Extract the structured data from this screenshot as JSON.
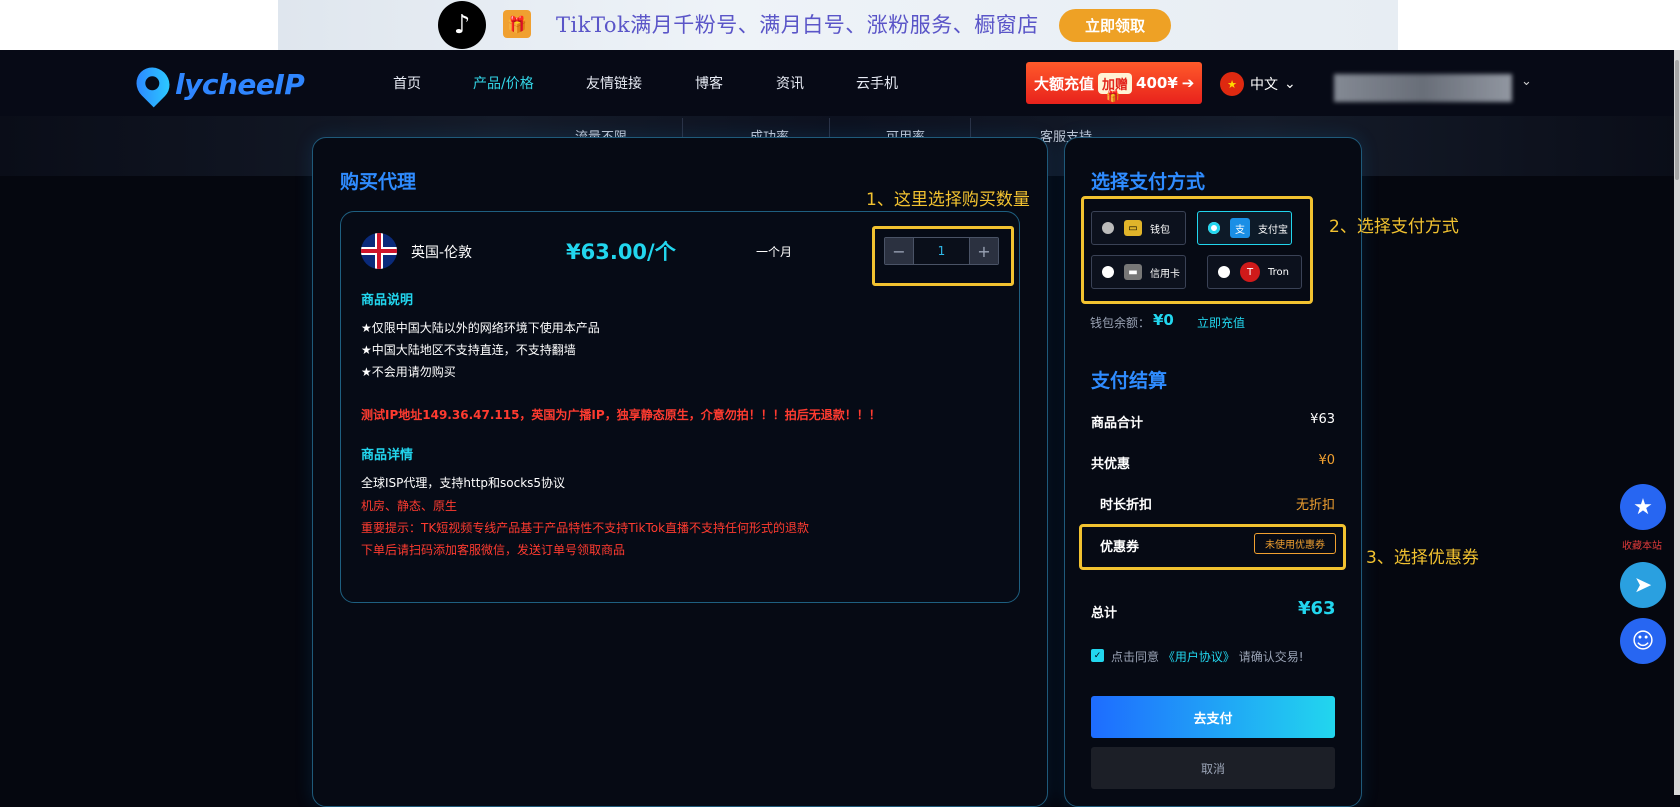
{
  "promo": {
    "text": "TikTok满月千粉号、满月白号、涨粉服务、橱窗店",
    "button": "立即领取",
    "tiktok_icon": "♪",
    "gift_icon": "🎁"
  },
  "nav": {
    "logo_text": "lycheeIP",
    "items": [
      "首页",
      "产品/价格",
      "友情链接",
      "博客",
      "资讯",
      "云手机"
    ],
    "active_index": 1,
    "recharge_banner": {
      "prefix": "大额充值",
      "tag": "加赠",
      "amount": "400¥",
      "arrow": "➔",
      "gift": "🎁"
    },
    "language": "中文",
    "language_flag": "★"
  },
  "hero_stats": [
    "流量不限",
    "成功率",
    "可用率",
    "客服支持"
  ],
  "left": {
    "title": "购买代理",
    "annotation": "1、这里选择购买数量",
    "product": {
      "name": "英国-伦敦",
      "price": "¥63.00/个",
      "period": "一个月",
      "quantity": "1",
      "minus": "−",
      "plus": "+"
    },
    "desc_title": "商品说明",
    "desc_lines": [
      "★仅限中国大陆以外的网络环境下使用本产品",
      "★中国大陆地区不支持直连，不支持翻墙",
      "★不会用请勿购买"
    ],
    "warning": "测试IP地址149.36.47.115，英国为广播IP，独享静态原生，介意勿拍！！！拍后无退款！！！",
    "detail_title": "商品详情",
    "detail_main": "全球ISP代理，支持http和socks5协议",
    "detail_red": [
      "机房、静态、原生",
      "重要提示：TK短视频专线产品基于产品特性不支持TikTok直播不支持任何形式的退款",
      "下单后请扫码添加客服微信，发送订单号领取商品"
    ]
  },
  "right": {
    "pay_title": "选择支付方式",
    "pay_annotation": "2、选择支付方式",
    "pay_methods": [
      {
        "label": "钱包",
        "icon": "▭",
        "selected": false
      },
      {
        "label": "支付宝",
        "icon": "支",
        "selected": true
      },
      {
        "label": "信用卡",
        "icon": "▬",
        "selected": false
      },
      {
        "label": "Tron",
        "icon": "T",
        "selected": false
      }
    ],
    "balance_label": "钱包余额：",
    "balance_value": "¥0",
    "recharge_link": "立即充值",
    "checkout_title": "支付结算",
    "rows": [
      {
        "label": "商品合计",
        "value": "¥63"
      },
      {
        "label": "共优惠",
        "value": "¥0"
      },
      {
        "label": "时长折扣",
        "value": "无折扣"
      },
      {
        "label": "优惠券",
        "value": "未使用优惠券"
      }
    ],
    "coupon_annotation": "3、选择优惠券",
    "total_label": "总计",
    "total_value": "¥63",
    "agree_prefix": "点击同意",
    "agree_link": "《用户协议》",
    "agree_suffix": "请确认交易!",
    "pay_button": "去支付",
    "cancel_button": "取消"
  },
  "side": {
    "bookmark_label": "收藏本站",
    "star_icon": "★",
    "telegram_icon": "➤",
    "support_icon": "☺"
  },
  "colors": {
    "accent_cyan": "#22d6ee",
    "accent_blue": "#2f8cff",
    "annotation_yellow": "#f2c230",
    "warning_red": "#ff3b30",
    "coupon_orange": "#f0a030"
  }
}
